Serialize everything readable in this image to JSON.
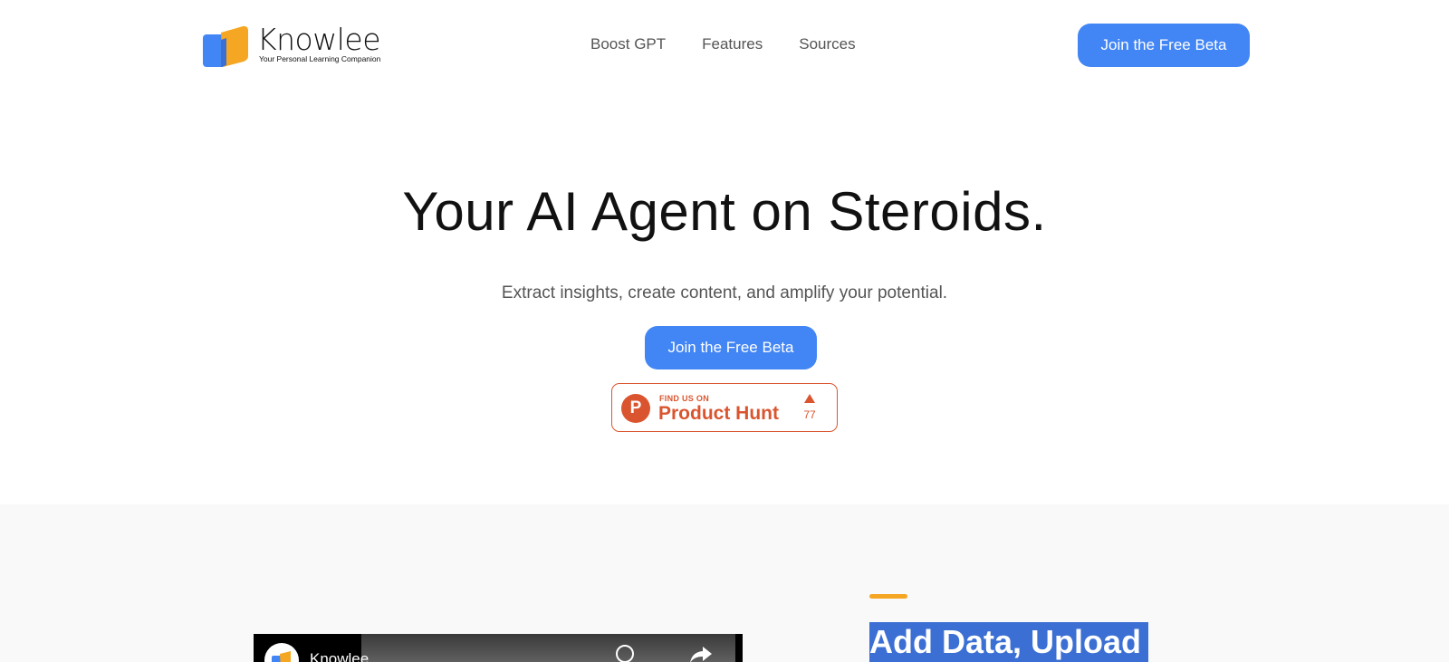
{
  "header": {
    "logo_title": "Knowlee",
    "logo_tagline": "Your Personal Learning Companion",
    "nav": [
      "Boost GPT",
      "Features",
      "Sources"
    ],
    "cta_label": "Join the Free Beta"
  },
  "hero": {
    "title": "Your AI Agent on Steroids.",
    "subtitle": "Extract insights, create content, and amplify your potential.",
    "cta_label": "Join the Free Beta",
    "product_hunt": {
      "find_label": "FIND US ON",
      "name": "Product Hunt",
      "logo_letter": "P",
      "upvotes": "77"
    }
  },
  "feature": {
    "video_title": "Knowlee",
    "heading": "Add Data, Upload"
  },
  "colors": {
    "accent_blue": "#4285f4",
    "product_hunt": "#da552f",
    "accent_orange": "#f5a623",
    "heading_highlight": "#3b6fd4"
  },
  "icons": {
    "logo": "knowlee-logo-icon",
    "product_hunt": "product-hunt-icon",
    "upvote": "upvote-arrow-icon",
    "watch_later": "clock-icon",
    "share": "share-icon"
  }
}
